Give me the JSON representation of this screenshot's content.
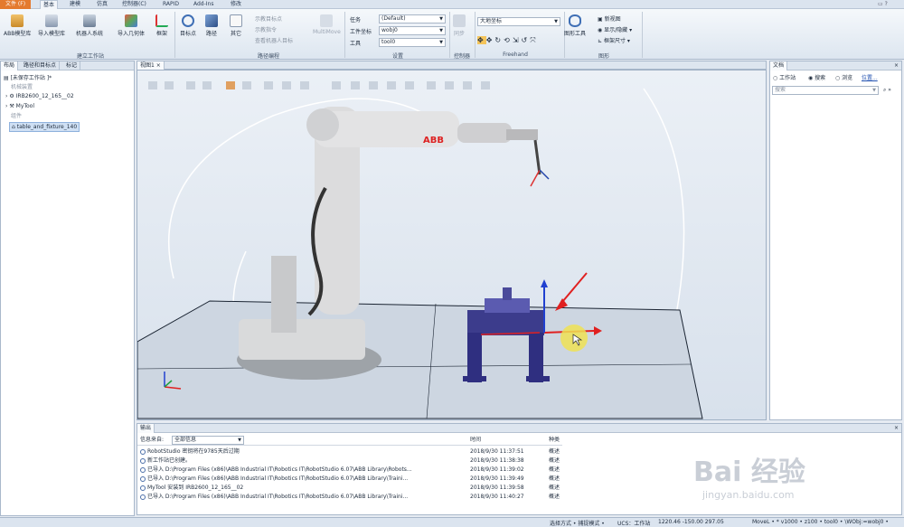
{
  "menu": {
    "file": "文件 (F)",
    "tabs": [
      "基本",
      "建模",
      "仿真",
      "控制器(C)",
      "RAPID",
      "Add-Ins",
      "修改"
    ],
    "active_index": 0
  },
  "ribbon": {
    "build_station": {
      "buttons": [
        "ABB模型库",
        "导入模型库",
        "机器人系统",
        "导入几何体",
        "框架"
      ],
      "group_label": "建立工作站"
    },
    "path_programming": {
      "buttons": [
        "目标点",
        "路径",
        "其它"
      ],
      "small_items": [
        "示教目标点",
        "示教指令",
        "查看机器人目标"
      ],
      "multimove": "MultiMove",
      "group_label": "路径编程"
    },
    "settings": {
      "task_label": "任务",
      "task_value": "(Default)",
      "wobj_label": "工件坐标",
      "wobj_value": "wobj0",
      "tool_label": "工具",
      "tool_value": "tool0",
      "group_label": "设置"
    },
    "controller": {
      "button": "同步",
      "group_label": "控制器"
    },
    "freehand": {
      "frame_value": "大地坐标",
      "group_label": "Freehand"
    },
    "graphics": {
      "button": "图形工具",
      "small_items": [
        "新视图",
        "显示/隐藏",
        "框架尺寸"
      ],
      "group_label": "图形"
    }
  },
  "left_panel": {
    "tabs": [
      "布局",
      "路径和目标点",
      "标记"
    ],
    "station_title": "[未保存工作站 ]*",
    "mechanisms_label": "机械装置",
    "robot": "IRB2600_12_165__02",
    "tool": "MyTool",
    "components_label": "组件",
    "component": "table_and_fixture_140"
  },
  "viewport": {
    "tab": "视图1",
    "close": "×",
    "brand": "ABB"
  },
  "right_panel": {
    "title": "文档",
    "opt_station": "工作站",
    "opt_search": "搜索",
    "opt_browse": "浏览",
    "location": "位置...",
    "search_placeholder": "搜索"
  },
  "output": {
    "title": "输出",
    "source_label": "信息来自:",
    "source_value": "全部信息",
    "col_time": "时间",
    "col_type": "种类",
    "rows": [
      {
        "msg": "RobotStudio 密钥将在9785天后过期",
        "time": "2018/9/30 11:37:51",
        "type": "概述"
      },
      {
        "msg": "新工作站已创建。",
        "time": "2018/9/30 11:38:38",
        "type": "概述"
      },
      {
        "msg": "已导入 D:\\Program Files (x86)\\ABB Industrial IT\\Robotics IT\\RobotStudio 6.07\\ABB Library\\Robots...",
        "time": "2018/9/30 11:39:02",
        "type": "概述"
      },
      {
        "msg": "已导入 D:\\Program Files (x86)\\ABB Industrial IT\\Robotics IT\\RobotStudio 6.07\\ABB Library\\Traini...",
        "time": "2018/9/30 11:39:49",
        "type": "概述"
      },
      {
        "msg": "MyTool 安装到 IRB2600_12_165__02",
        "time": "2018/9/30 11:39:58",
        "type": "概述"
      },
      {
        "msg": "已导入 D:\\Program Files (x86)\\ABB Industrial IT\\Robotics IT\\RobotStudio 6.07\\ABB Library\\Traini...",
        "time": "2018/9/30 11:40:27",
        "type": "概述"
      }
    ]
  },
  "status": {
    "mode": "选择方式 • 捕捉模式 •",
    "ucs": "UCS：工作站",
    "coords": "1220.46   -150.00   297.05",
    "instruction": "MoveL • * v1000 • z100 • tool0 • \\WObj:=wobj0 •"
  },
  "watermark": {
    "text": "Bai 经验",
    "url": "jingyan.baidu.com"
  }
}
